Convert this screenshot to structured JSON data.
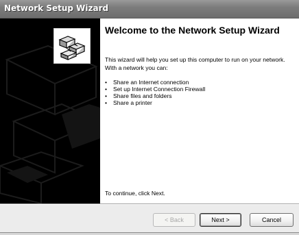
{
  "window": {
    "title": "Network Setup Wizard"
  },
  "content": {
    "heading": "Welcome to the Network Setup Wizard",
    "intro": "This wizard will help you set up this computer to run on your network. With a network you can:",
    "bullets": [
      "Share an Internet connection",
      "Set up Internet Connection Firewall",
      "Share files and folders",
      "Share a printer"
    ],
    "continue_text": "To continue, click Next."
  },
  "buttons": {
    "back": "< Back",
    "next": "Next >",
    "cancel": "Cancel"
  },
  "icons": {
    "wizard": "network-computers-icon",
    "bullet": "•"
  }
}
